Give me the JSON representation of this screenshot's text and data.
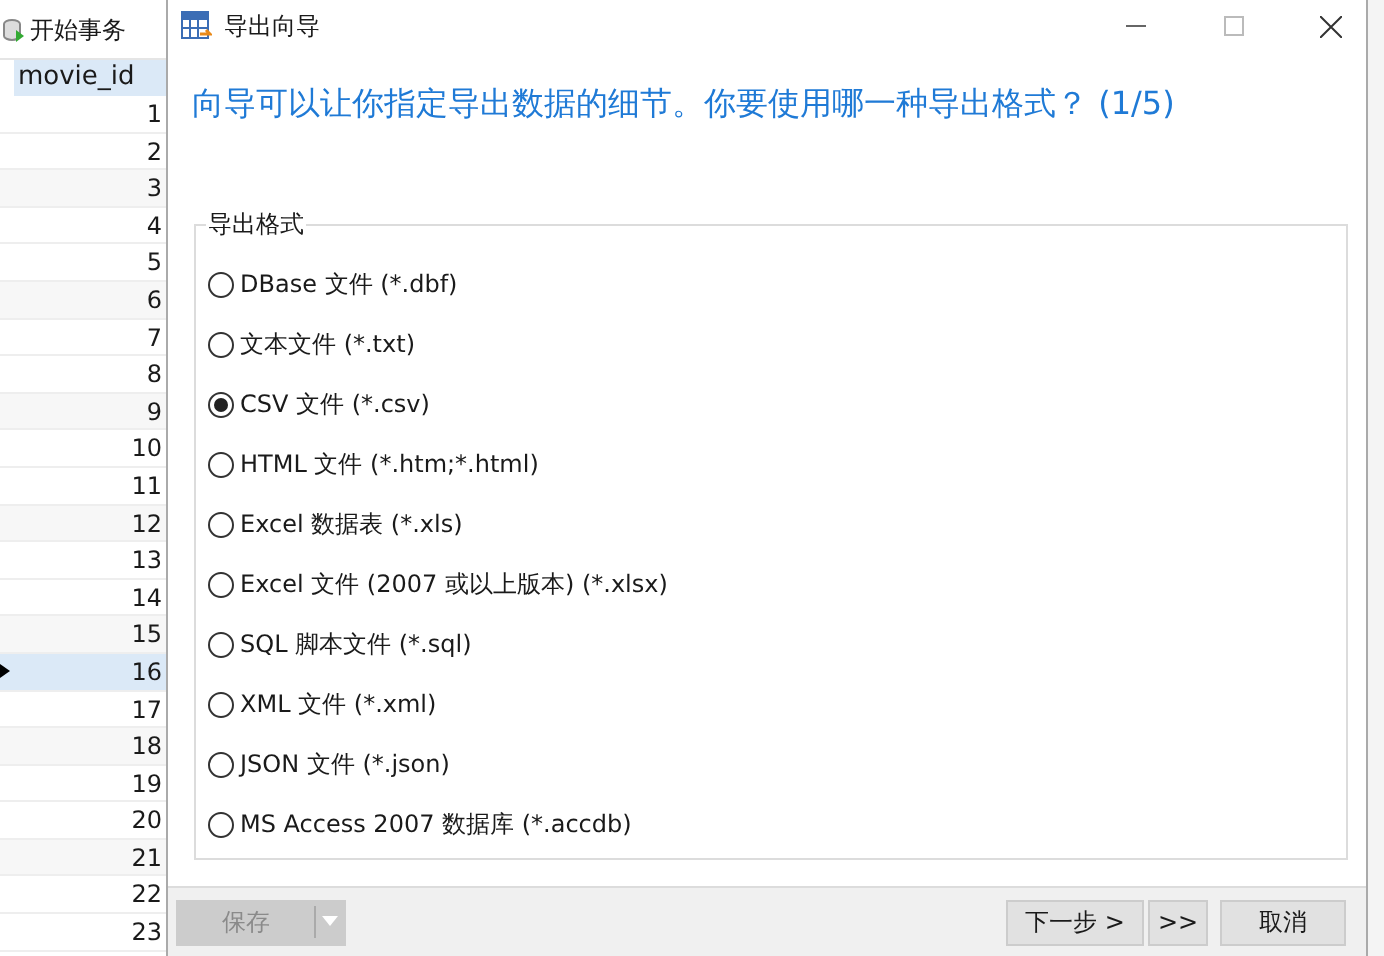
{
  "background_app": {
    "toolbar_button": "开始事务",
    "table": {
      "column": "movie_id",
      "rows": [
        {
          "value": "1",
          "current": false
        },
        {
          "value": "2",
          "current": false
        },
        {
          "value": "3",
          "current": false
        },
        {
          "value": "4",
          "current": false
        },
        {
          "value": "5",
          "current": false
        },
        {
          "value": "6",
          "current": false
        },
        {
          "value": "7",
          "current": false
        },
        {
          "value": "8",
          "current": false
        },
        {
          "value": "9",
          "current": false
        },
        {
          "value": "10",
          "current": false
        },
        {
          "value": "11",
          "current": false
        },
        {
          "value": "12",
          "current": false
        },
        {
          "value": "13",
          "current": false
        },
        {
          "value": "14",
          "current": false
        },
        {
          "value": "15",
          "current": false
        },
        {
          "value": "16",
          "current": true
        },
        {
          "value": "17",
          "current": false
        },
        {
          "value": "18",
          "current": false
        },
        {
          "value": "19",
          "current": false
        },
        {
          "value": "20",
          "current": false
        },
        {
          "value": "21",
          "current": false
        },
        {
          "value": "22",
          "current": false
        },
        {
          "value": "23",
          "current": false
        }
      ]
    }
  },
  "window": {
    "title": "导出向导"
  },
  "heading": "向导可以让你指定导出数据的细节。你要使用哪一种导出格式？ (1/5)",
  "format_group": {
    "label": "导出格式",
    "options": [
      {
        "label": "DBase 文件 (*.dbf)",
        "selected": false
      },
      {
        "label": "文本文件 (*.txt)",
        "selected": false
      },
      {
        "label": "CSV 文件 (*.csv)",
        "selected": true
      },
      {
        "label": "HTML 文件 (*.htm;*.html)",
        "selected": false
      },
      {
        "label": "Excel 数据表 (*.xls)",
        "selected": false
      },
      {
        "label": "Excel 文件 (2007 或以上版本) (*.xlsx)",
        "selected": false
      },
      {
        "label": "SQL 脚本文件 (*.sql)",
        "selected": false
      },
      {
        "label": "XML 文件 (*.xml)",
        "selected": false
      },
      {
        "label": "JSON 文件 (*.json)",
        "selected": false
      },
      {
        "label": "MS Access 2007 数据库 (*.accdb)",
        "selected": false
      }
    ]
  },
  "buttons": {
    "save": {
      "label": "保存",
      "disabled": true
    },
    "next": "下一步 >",
    "last": ">>",
    "cancel": "取消"
  }
}
